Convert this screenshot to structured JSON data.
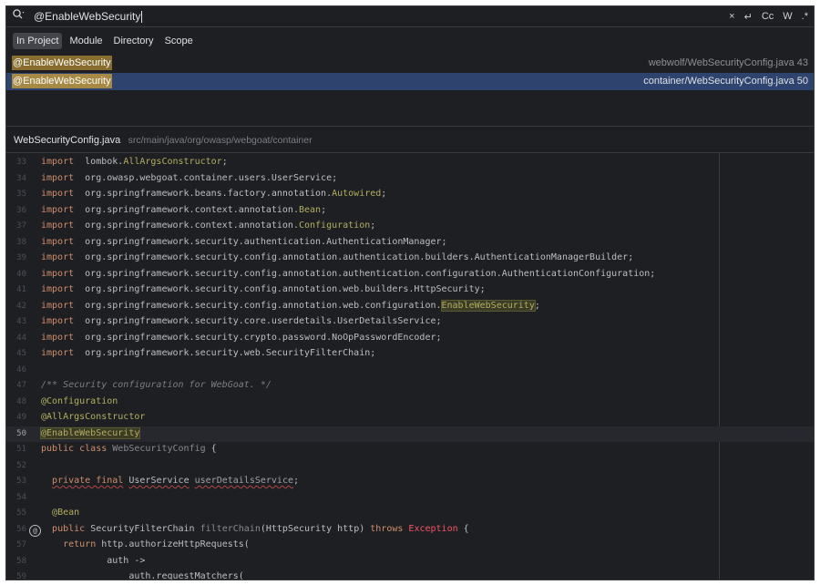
{
  "search": {
    "query": "@EnableWebSecurity",
    "icon": "search-history-icon",
    "tools": {
      "clear": "×",
      "newline": "↵",
      "match_case": "Cc",
      "words": "W",
      "regex": ".*"
    }
  },
  "scopes": [
    {
      "label": "In Project",
      "active": true
    },
    {
      "label": "Module",
      "active": false
    },
    {
      "label": "Directory",
      "active": false
    },
    {
      "label": "Scope",
      "active": false
    }
  ],
  "results": [
    {
      "match": "@EnableWebSecurity",
      "location": "webwolf/WebSecurityConfig.java 43",
      "selected": false
    },
    {
      "match": "@EnableWebSecurity",
      "location": "container/WebSecurityConfig.java 50",
      "selected": true
    }
  ],
  "preview": {
    "file_name": "WebSecurityConfig.java",
    "file_path": "src/main/java/org/owasp/webgoat/container",
    "current_line": 50,
    "lines": [
      {
        "n": "33",
        "segs": [
          [
            "kw",
            "import"
          ],
          [
            "",
            "  lombok."
          ],
          [
            "ann",
            "AllArgsConstructor"
          ],
          [
            "",
            ";"
          ]
        ]
      },
      {
        "n": "34",
        "segs": [
          [
            "kw",
            "import"
          ],
          [
            "",
            "  org.owasp.webgoat.container.users.UserService;"
          ]
        ]
      },
      {
        "n": "35",
        "segs": [
          [
            "kw",
            "import"
          ],
          [
            "",
            "  org.springframework.beans.factory.annotation."
          ],
          [
            "ann",
            "Autowired"
          ],
          [
            "",
            ";"
          ]
        ]
      },
      {
        "n": "36",
        "segs": [
          [
            "kw",
            "import"
          ],
          [
            "",
            "  org.springframework.context.annotation."
          ],
          [
            "ann",
            "Bean"
          ],
          [
            "",
            ";"
          ]
        ]
      },
      {
        "n": "37",
        "segs": [
          [
            "kw",
            "import"
          ],
          [
            "",
            "  org.springframework.context.annotation."
          ],
          [
            "ann",
            "Configuration"
          ],
          [
            "",
            ";"
          ]
        ]
      },
      {
        "n": "38",
        "segs": [
          [
            "kw",
            "import"
          ],
          [
            "",
            "  org.springframework.security.authentication.AuthenticationManager;"
          ]
        ]
      },
      {
        "n": "39",
        "segs": [
          [
            "kw",
            "import"
          ],
          [
            "",
            "  org.springframework.security.config.annotation.authentication.builders.AuthenticationManagerBuilder;"
          ]
        ]
      },
      {
        "n": "40",
        "segs": [
          [
            "kw",
            "import"
          ],
          [
            "",
            "  org.springframework.security.config.annotation.authentication.configuration.AuthenticationConfiguration;"
          ]
        ]
      },
      {
        "n": "41",
        "segs": [
          [
            "kw",
            "import"
          ],
          [
            "",
            "  org.springframework.security.config.annotation.web.builders.HttpSecurity;"
          ]
        ]
      },
      {
        "n": "42",
        "segs": [
          [
            "kw",
            "import"
          ],
          [
            "",
            "  org.springframework.security.config.annotation.web.configuration."
          ],
          [
            "ann hl",
            "EnableWebSecurity"
          ],
          [
            "",
            ";"
          ]
        ]
      },
      {
        "n": "43",
        "segs": [
          [
            "kw",
            "import"
          ],
          [
            "",
            "  org.springframework.security.core.userdetails.UserDetailsService;"
          ]
        ]
      },
      {
        "n": "44",
        "segs": [
          [
            "kw",
            "import"
          ],
          [
            "",
            "  org.springframework.security.crypto.password.NoOpPasswordEncoder;"
          ]
        ]
      },
      {
        "n": "45",
        "segs": [
          [
            "kw",
            "import"
          ],
          [
            "",
            "  org.springframework.security.web.SecurityFilterChain;"
          ]
        ]
      },
      {
        "n": "46",
        "segs": []
      },
      {
        "n": "47",
        "segs": [
          [
            "cmt",
            "/** Security configuration for WebGoat. */"
          ]
        ]
      },
      {
        "n": "48",
        "segs": [
          [
            "ann",
            "@Configuration"
          ]
        ]
      },
      {
        "n": "49",
        "segs": [
          [
            "ann",
            "@AllArgsConstructor"
          ]
        ]
      },
      {
        "n": "50",
        "segs": [
          [
            "ann hl",
            "@EnableWebSecurity"
          ]
        ]
      },
      {
        "n": "51",
        "segs": [
          [
            "kw",
            "public class"
          ],
          [
            "",
            " "
          ],
          [
            "dim",
            "WebSecurityConfig"
          ],
          [
            "",
            " {"
          ]
        ]
      },
      {
        "n": "52",
        "segs": []
      },
      {
        "n": "53",
        "segs": [
          [
            "",
            "  "
          ],
          [
            "kw sq",
            "private final"
          ],
          [
            "",
            " "
          ],
          [
            "sq",
            "UserService"
          ],
          [
            "",
            " "
          ],
          [
            "fld sq",
            "userDetailsService"
          ],
          [
            "",
            ";"
          ]
        ]
      },
      {
        "n": "54",
        "segs": []
      },
      {
        "n": "55",
        "segs": [
          [
            "",
            "  "
          ],
          [
            "ann",
            "@Bean"
          ]
        ]
      },
      {
        "n": "56",
        "segs": [
          [
            "",
            "  "
          ],
          [
            "kw",
            "public"
          ],
          [
            "",
            " SecurityFilterChain "
          ],
          [
            "dim",
            "filterChain"
          ],
          [
            "",
            "(HttpSecurity http) "
          ],
          [
            "kw",
            "throws"
          ],
          [
            "",
            " "
          ],
          [
            "exc",
            "Exception"
          ],
          [
            "",
            " {"
          ]
        ]
      },
      {
        "n": "57",
        "segs": [
          [
            "",
            "    "
          ],
          [
            "kw",
            "return"
          ],
          [
            "",
            " http.authorizeHttpRequests("
          ]
        ]
      },
      {
        "n": "58",
        "segs": [
          [
            "",
            "            auth ->"
          ]
        ]
      },
      {
        "n": "59",
        "segs": [
          [
            "",
            "                auth.requestMatchers("
          ]
        ]
      }
    ]
  },
  "colors": {
    "panel_bg": "#1e1f22",
    "selection": "#2e436e",
    "match_bg": "#a68944",
    "keyword": "#cf8e6d",
    "annotation": "#b3ae60",
    "comment": "#7a7e85",
    "error": "#f75464"
  }
}
